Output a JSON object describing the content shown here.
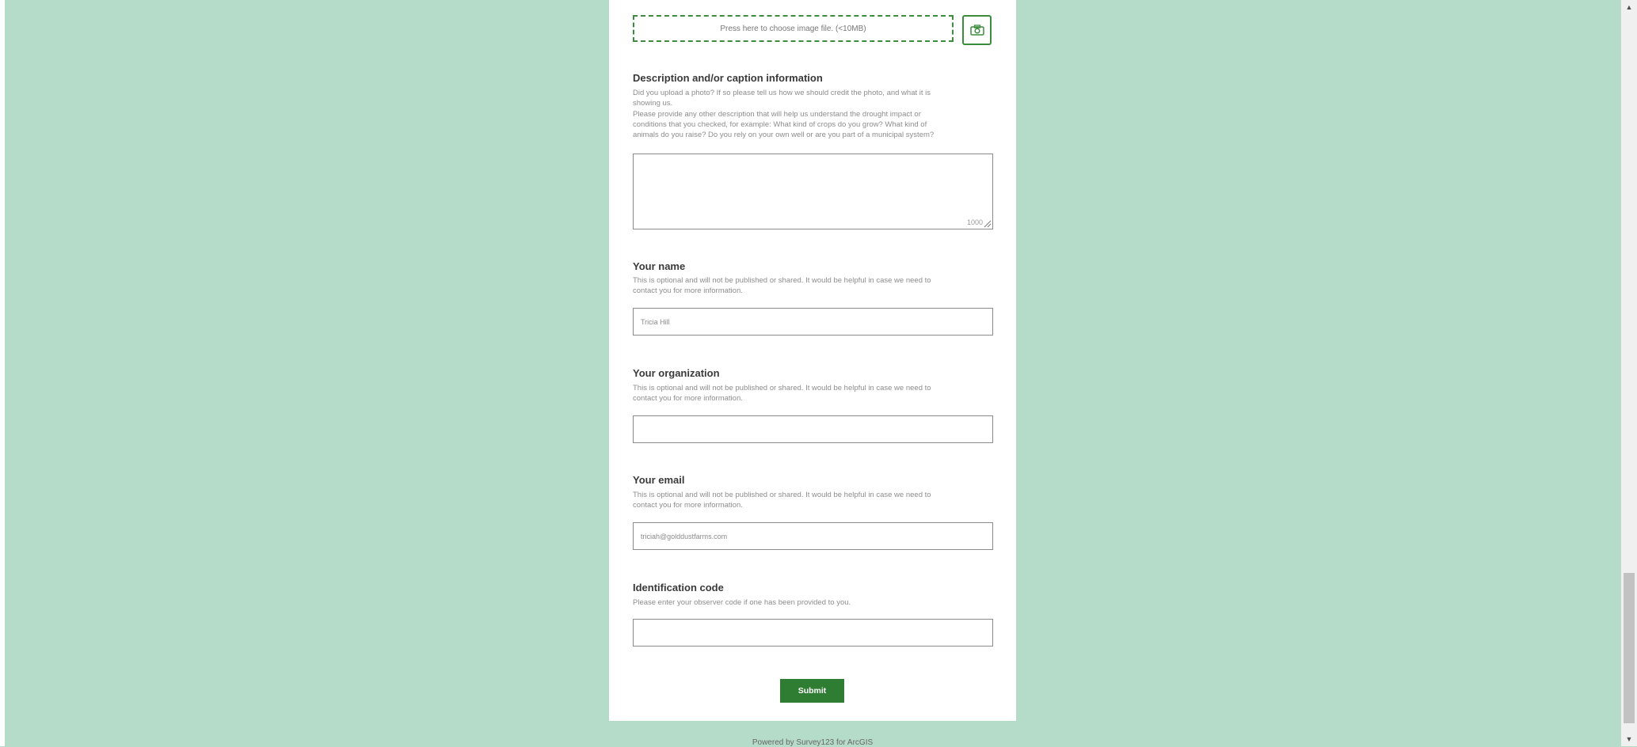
{
  "image_upload": {
    "prompt": "Press here to choose image file. (<10MB)",
    "button_icon": "camera-icon"
  },
  "description": {
    "title": "Description and/or caption information",
    "hint_lines": [
      "Did you upload a photo? If so please tell us how we should credit the photo, and what it is",
      "showing us.",
      "Please provide any other description that will help us understand the drought impact or",
      "conditions that you checked, for example: What kind of crops do you grow? What kind of",
      "animals do you raise? Do you rely on your own well or are you part of a municipal system?"
    ],
    "char_limit": "1000"
  },
  "name": {
    "title": "Your name",
    "hint_lines": [
      "This is optional and will not be published or shared. It would be helpful in case we need to",
      "contact you for more information."
    ],
    "value": "Tricia Hill"
  },
  "organization": {
    "title": "Your organization",
    "hint_lines": [
      "This is optional and will not be published or shared. It would be helpful in case we need to",
      "contact you for more information."
    ],
    "value": ""
  },
  "email": {
    "title": "Your email",
    "hint_lines": [
      "This is optional and will not be published or shared. It would be helpful in case we need to",
      "contact you for more information."
    ],
    "value": "triciah@golddustfarms.com"
  },
  "identification": {
    "title": "Identification code",
    "hint": "Please enter your observer code if one has been provided to you.",
    "value": ""
  },
  "submit_label": "Submit",
  "footer": "Powered by Survey123 for ArcGIS",
  "scrollbar": {
    "up_icon": "arrow-up-icon",
    "down_icon": "arrow-down-icon"
  },
  "colors": {
    "page_background": "#b5dcc8",
    "accent_green": "#2e7d32",
    "dashed_border": "#3d8b3d"
  }
}
